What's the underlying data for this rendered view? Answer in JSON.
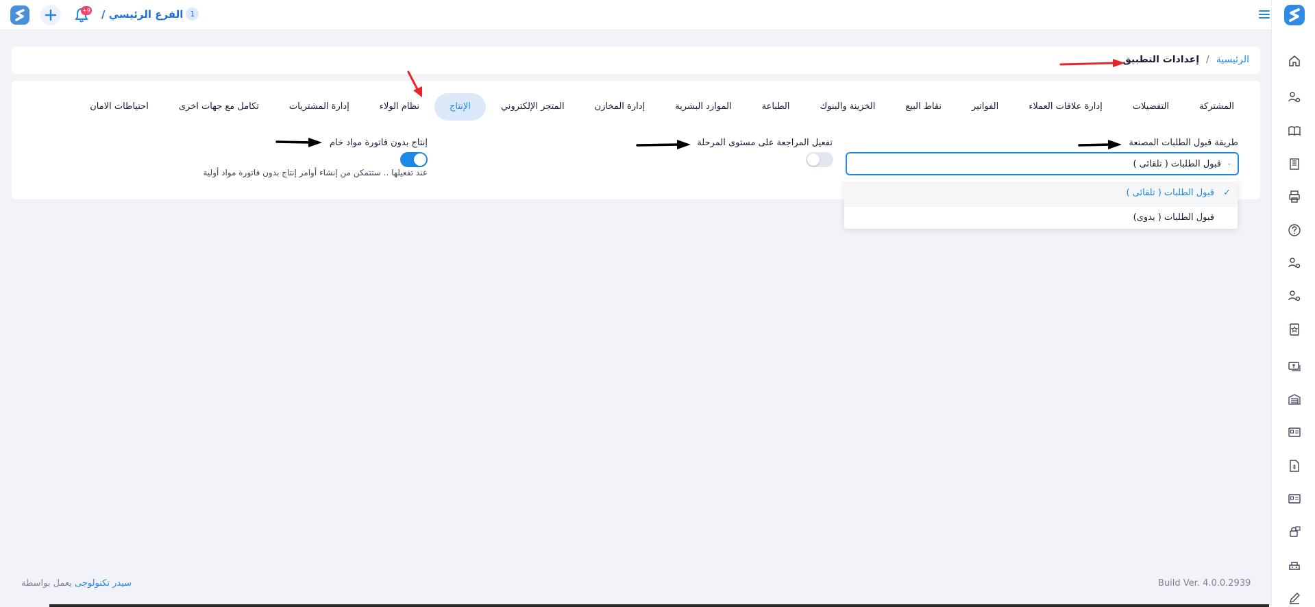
{
  "header": {
    "branch_name": "الفرع الرئيسي /",
    "branch_number": "1",
    "notification_count": "+9"
  },
  "breadcrumb": {
    "home": "الرئيسية",
    "separator": "/",
    "current": "إعدادات التطبيق"
  },
  "tabs": [
    {
      "label": "المشتركة",
      "active": false
    },
    {
      "label": "التفضيلات",
      "active": false
    },
    {
      "label": "إدارة علاقات العملاء",
      "active": false
    },
    {
      "label": "الفواتير",
      "active": false
    },
    {
      "label": "نقاط البيع",
      "active": false
    },
    {
      "label": "الخزينة والبنوك",
      "active": false
    },
    {
      "label": "الطباعة",
      "active": false
    },
    {
      "label": "الموارد البشرية",
      "active": false
    },
    {
      "label": "إدارة المخازن",
      "active": false
    },
    {
      "label": "المتجر الإلكتروني",
      "active": false
    },
    {
      "label": "الإنتاج",
      "active": true
    },
    {
      "label": "نظام الولاء",
      "active": false
    },
    {
      "label": "إدارة المشتريات",
      "active": false
    },
    {
      "label": "تكامل مع جهات اخرى",
      "active": false
    },
    {
      "label": "احتياطات الامان",
      "active": false
    }
  ],
  "settings": {
    "order_acceptance": {
      "label": "طريقة قبول الطلبات المصنعة",
      "selected": "قبول الطلبات ( تلقائى )",
      "options": [
        "قبول الطلبات ( تلقائى )",
        "قبول الطلبات ( يدوى)"
      ]
    },
    "stage_review": {
      "label": "تفعيل المراجعة على مستوى المرحلة",
      "enabled": false
    },
    "production_without_invoice": {
      "label": "إنتاج بدون فاتورة مواد خام",
      "hint": "عند تفعيلها .. ستتمكن من إنشاء أوامر إنتاج بدون فاتورة مواد أولية",
      "enabled": true
    }
  },
  "footer": {
    "powered_by": "يعمل بواسطة",
    "brand": "سيدر تكنولوجى",
    "build": "Build Ver. 4.0.0.2939"
  },
  "colors": {
    "accent": "#1e88e5",
    "annotation_red": "#e8242b",
    "annotation_black": "#000000"
  }
}
